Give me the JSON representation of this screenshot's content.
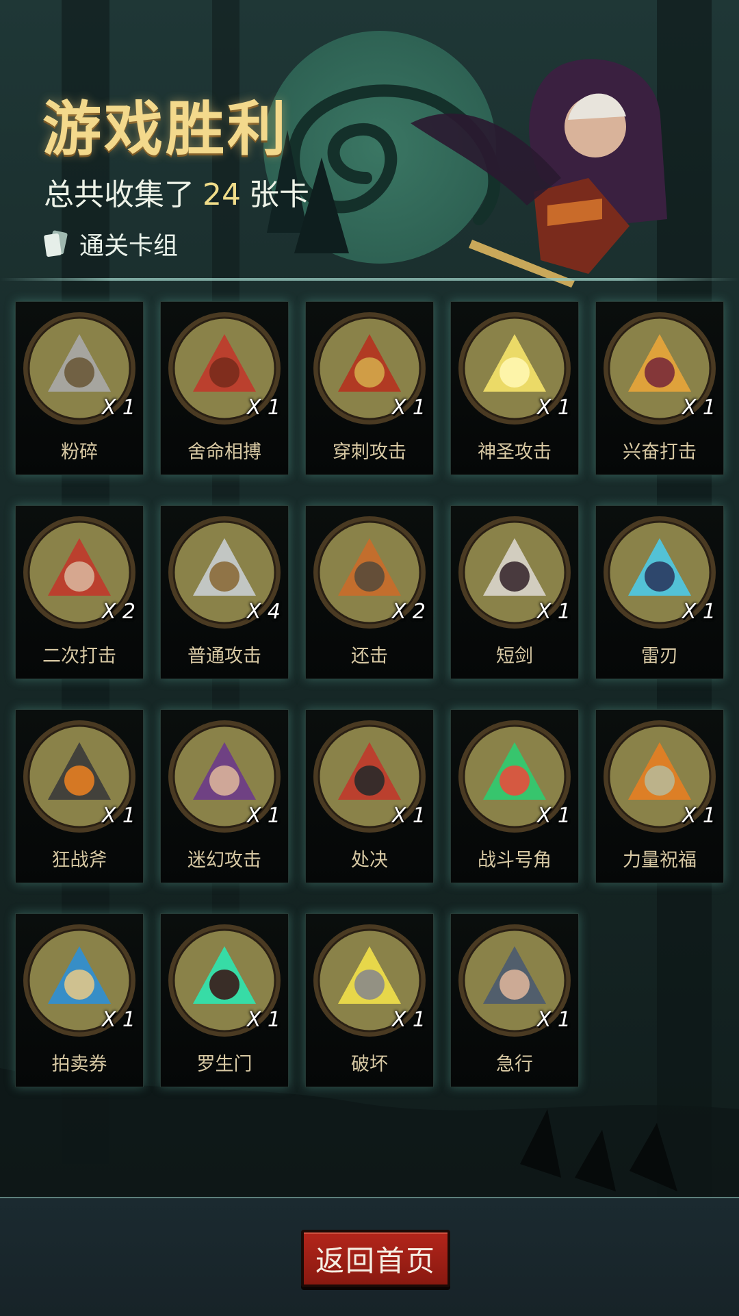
{
  "header": {
    "title": "游戏胜利",
    "subtitle_prefix": "总共收集了",
    "card_total": "24",
    "subtitle_suffix": "张卡",
    "deck_label": "通关卡组",
    "deck_icon": "cards-icon"
  },
  "cards": [
    {
      "name": "粉碎",
      "count": "X 1",
      "icon": "mace-smash-icon"
    },
    {
      "name": "舍命相搏",
      "count": "X 1",
      "icon": "hooded-fighter-icon"
    },
    {
      "name": "穿刺攻击",
      "count": "X 1",
      "icon": "spikes-icon"
    },
    {
      "name": "神圣攻击",
      "count": "X 1",
      "icon": "holy-light-icon"
    },
    {
      "name": "兴奋打击",
      "count": "X 1",
      "icon": "flaming-warrior-icon"
    },
    {
      "name": "二次打击",
      "count": "X 2",
      "icon": "dual-daggers-icon"
    },
    {
      "name": "普通攻击",
      "count": "X 4",
      "icon": "sword-icon"
    },
    {
      "name": "还击",
      "count": "X 2",
      "icon": "dwarf-warrior-icon"
    },
    {
      "name": "短剑",
      "count": "X 1",
      "icon": "short-sword-icon"
    },
    {
      "name": "雷刃",
      "count": "X 1",
      "icon": "thunder-blade-icon"
    },
    {
      "name": "狂战斧",
      "count": "X 1",
      "icon": "pumpkin-axe-icon"
    },
    {
      "name": "迷幻攻击",
      "count": "X 1",
      "icon": "witch-icon"
    },
    {
      "name": "处决",
      "count": "X 1",
      "icon": "guillotine-icon"
    },
    {
      "name": "战斗号角",
      "count": "X 1",
      "icon": "war-horn-icon"
    },
    {
      "name": "力量祝福",
      "count": "X 1",
      "icon": "fist-icon"
    },
    {
      "name": "拍卖券",
      "count": "X 1",
      "icon": "gavel-icon"
    },
    {
      "name": "罗生门",
      "count": "X 1",
      "icon": "demon-gate-icon"
    },
    {
      "name": "破坏",
      "count": "X 1",
      "icon": "hammer-break-icon"
    },
    {
      "name": "急行",
      "count": "X 1",
      "icon": "running-warrior-icon"
    }
  ],
  "footer": {
    "home_button": "返回首页"
  },
  "colors": {
    "title": "#f3d98c",
    "card_label": "#d8c9a4",
    "medallion": "#8a8249",
    "medallion_rim": "#4a3a22",
    "button": "#a3221a"
  }
}
